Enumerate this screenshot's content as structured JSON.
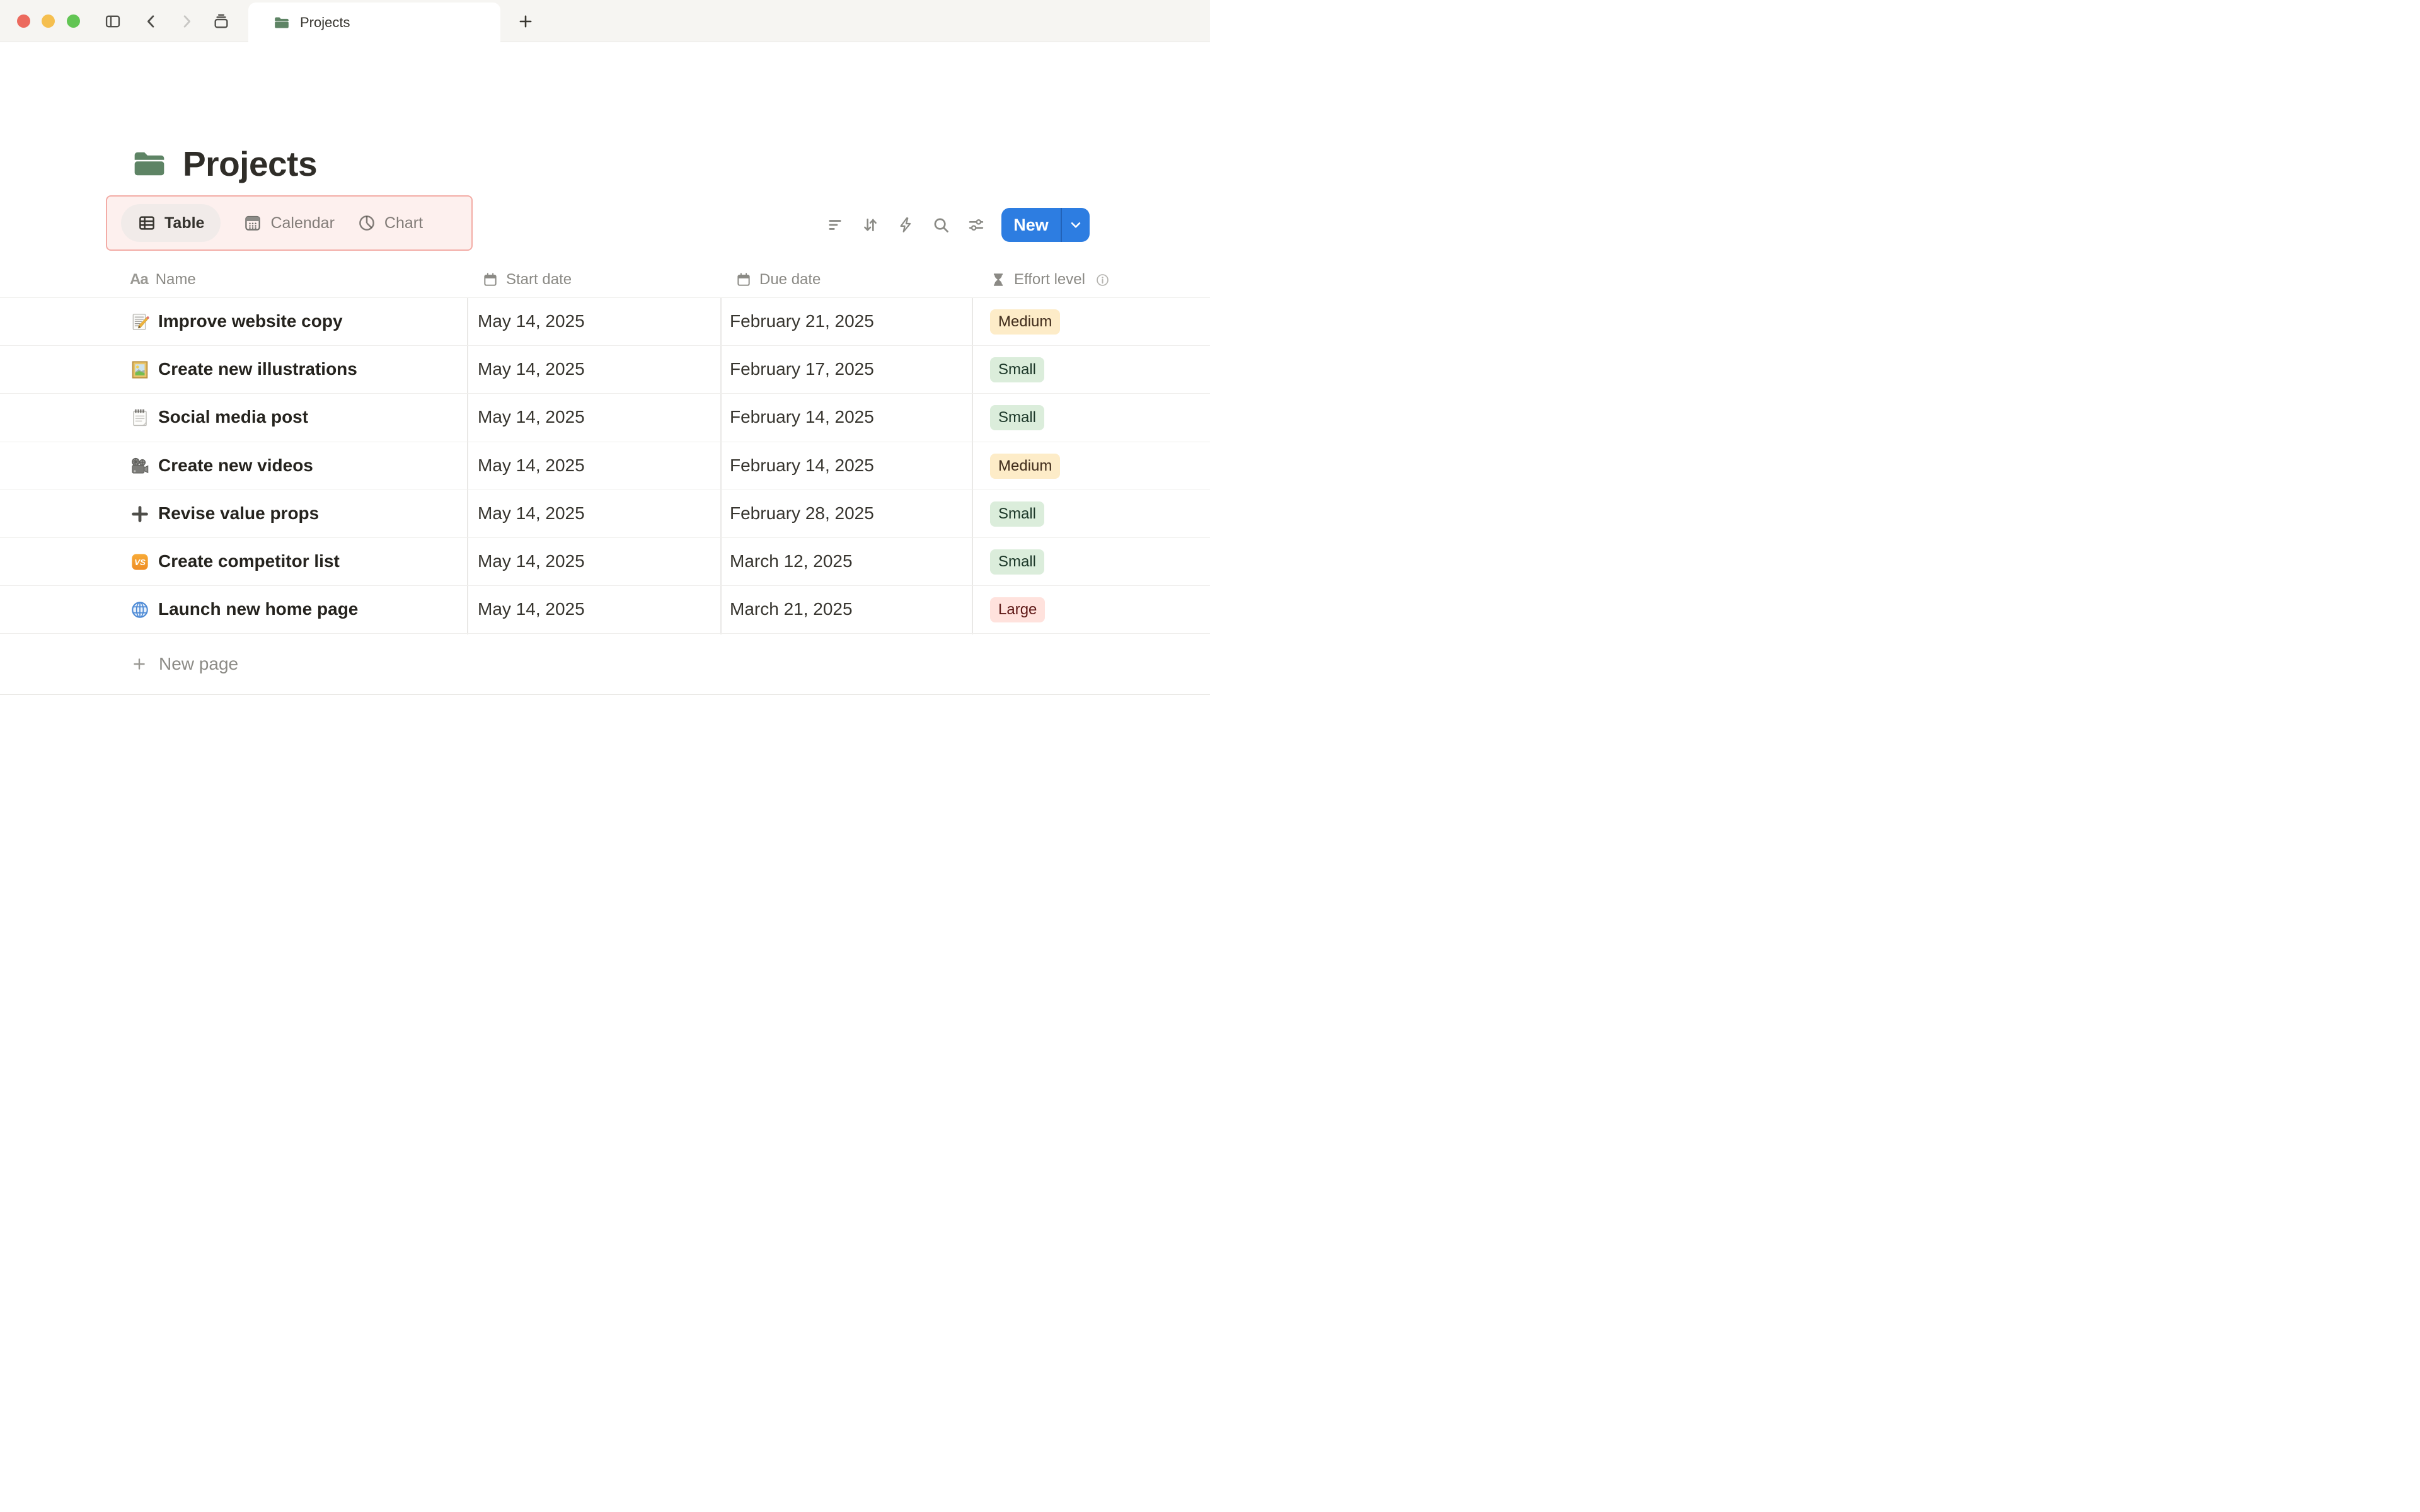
{
  "window": {
    "tab_title": "Projects",
    "traffic_lights": [
      "close",
      "minimize",
      "zoom"
    ],
    "nav_icons": [
      "sidebar-toggle",
      "back",
      "forward",
      "tab-stack"
    ],
    "new_tab_icon": "plus"
  },
  "page": {
    "title": "Projects",
    "icon": "folder"
  },
  "view_tabs": [
    {
      "label": "Table",
      "icon": "table-grid",
      "active": true
    },
    {
      "label": "Calendar",
      "icon": "calendar-emoji",
      "active": false
    },
    {
      "label": "Chart",
      "icon": "pie-chart",
      "active": false
    }
  ],
  "toolbar": {
    "icons": [
      "filter",
      "sort",
      "automation-bolt",
      "search",
      "view-settings"
    ],
    "new_label": "New"
  },
  "table": {
    "columns": [
      {
        "label": "Name",
        "icon": "text-aa"
      },
      {
        "label": "Start date",
        "icon": "calendar"
      },
      {
        "label": "Due date",
        "icon": "calendar"
      },
      {
        "label": "Effort level",
        "icon": "hourglass",
        "info": true
      }
    ],
    "rows": [
      {
        "icon": "memo",
        "name": "Improve website copy",
        "start": "May 14, 2025",
        "due": "February 21, 2025",
        "effort": "Medium"
      },
      {
        "icon": "picture",
        "name": "Create new illustrations",
        "start": "May 14, 2025",
        "due": "February 17, 2025",
        "effort": "Small"
      },
      {
        "icon": "notepad",
        "name": "Social media post",
        "start": "May 14, 2025",
        "due": "February 14, 2025",
        "effort": "Small"
      },
      {
        "icon": "movie-camera",
        "name": "Create new videos",
        "start": "May 14, 2025",
        "due": "February 14, 2025",
        "effort": "Medium"
      },
      {
        "icon": "plus-bold",
        "name": "Revise value props",
        "start": "May 14, 2025",
        "due": "February 28, 2025",
        "effort": "Small"
      },
      {
        "icon": "vs",
        "name": "Create competitor list",
        "start": "May 14, 2025",
        "due": "March 12, 2025",
        "effort": "Small"
      },
      {
        "icon": "globe",
        "name": "Launch new home page",
        "start": "May 14, 2025",
        "due": "March 21, 2025",
        "effort": "Large"
      }
    ],
    "new_page_label": "New page"
  },
  "effort_colors": {
    "Small": {
      "bg": "#dbeddb",
      "text": "#1c3829"
    },
    "Medium": {
      "bg": "#fdecc8",
      "text": "#402c1b"
    },
    "Large": {
      "bg": "#ffe2dd",
      "text": "#5d1715"
    }
  },
  "colors": {
    "accent_blue": "#2d7de1",
    "highlight_pink_bg": "#fdf0ee",
    "highlight_pink_border": "#f3aca6",
    "folder_green": "#5e8465",
    "tab_bar_bg": "#f6f5f2"
  }
}
